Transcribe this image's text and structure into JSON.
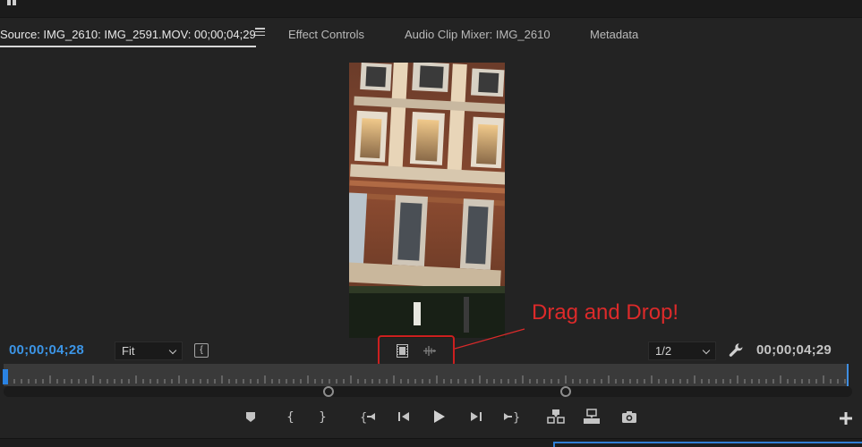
{
  "panel": {
    "tabs": [
      {
        "label": "Source: IMG_2610: IMG_2591.MOV: 00;00;04;29",
        "active": true
      },
      {
        "label": "Effect Controls"
      },
      {
        "label": "Audio Clip Mixer: IMG_2610"
      },
      {
        "label": "Metadata"
      }
    ]
  },
  "status": {
    "playhead_timecode": "00;00;04;28",
    "duration_timecode": "00;00;04;29",
    "zoom_select": "Fit",
    "resolution_select": "1/2"
  },
  "annotation": {
    "text": "Drag and Drop!",
    "color": "#dc2a2a"
  },
  "colors": {
    "accent": "#3c95e6",
    "panel_bg": "#232323"
  },
  "icons": {
    "drag_video": "film-icon",
    "drag_audio": "audio-waveform-icon",
    "settings": "wrench-icon",
    "transport": [
      "marker-icon",
      "mark-in-icon",
      "mark-out-icon",
      "go-to-in-icon",
      "step-back-icon",
      "play-icon",
      "step-forward-icon",
      "go-to-out-icon",
      "insert-icon",
      "overwrite-icon",
      "camera-icon",
      "plus-icon"
    ]
  }
}
